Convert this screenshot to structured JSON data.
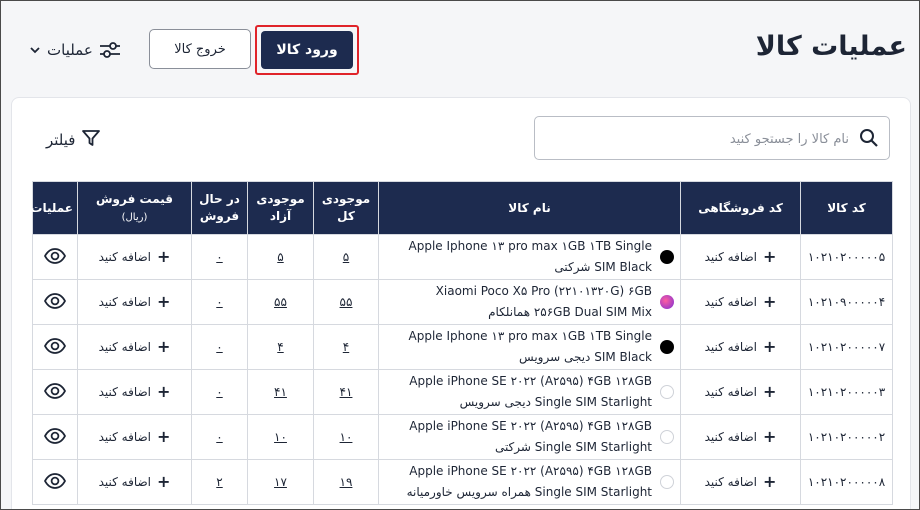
{
  "header": {
    "title": "عملیات کالا",
    "enter_button": "ورود کالا",
    "exit_button": "خروج کالا",
    "ops_menu": "عملیات"
  },
  "search": {
    "placeholder": "نام کالا را جستجو کنید"
  },
  "filter": {
    "label": "فیلتر"
  },
  "table": {
    "headers": {
      "code": "کد کالا",
      "shop_code": "کد فروشگاهی",
      "name": "نام کالا",
      "total_stock": "موجودی کل",
      "free_stock": "موجودی آزاد",
      "selling": "در حال فروش",
      "price": "قیمت فروش",
      "price_unit": "(ریال)",
      "ops": "عملیات"
    },
    "add_label": "اضافه کنید",
    "rows": [
      {
        "code": "۱۰۲۱۰۲۰۰۰۰۰۵",
        "name_line1": "Apple Iphone ۱۳ pro max ۱GB ۱TB Single",
        "name_line2": "SIM Black شرکتی",
        "color": "black",
        "total": "۵",
        "free": "۵",
        "selling": "۰"
      },
      {
        "code": "۱۰۲۱۰۹۰۰۰۰۰۴",
        "name_line1": "Xiaomi Poco X۵ Pro (۲۲۱۰۱۳۲۰G) ۶GB",
        "name_line2": "۲۵۶GB Dual SIM Mix همانلکام",
        "color": "purple",
        "total": "۵۵",
        "free": "۵۵",
        "selling": "۰"
      },
      {
        "code": "۱۰۲۱۰۲۰۰۰۰۰۷",
        "name_line1": "Apple Iphone ۱۳ pro max ۱GB ۱TB Single",
        "name_line2": "SIM Black دیجی سرویس",
        "color": "black",
        "total": "۴",
        "free": "۴",
        "selling": "۰"
      },
      {
        "code": "۱۰۲۱۰۲۰۰۰۰۰۳",
        "name_line1": "Apple iPhone SE ۲۰۲۲ (A۲۵۹۵) ۴GB ۱۲۸GB",
        "name_line2": "Single SIM Starlight دیجی سرویس",
        "color": "light",
        "total": "۴۱",
        "free": "۴۱",
        "selling": "۰"
      },
      {
        "code": "۱۰۲۱۰۲۰۰۰۰۰۲",
        "name_line1": "Apple iPhone SE ۲۰۲۲ (A۲۵۹۵) ۴GB ۱۲۸GB",
        "name_line2": "Single SIM Starlight شرکتی",
        "color": "light",
        "total": "۱۰",
        "free": "۱۰",
        "selling": "۰"
      },
      {
        "code": "۱۰۲۱۰۲۰۰۰۰۰۸",
        "name_line1": "Apple iPhone SE ۲۰۲۲ (A۲۵۹۵) ۴GB ۱۲۸GB",
        "name_line2": "Single SIM Starlight همراه سرویس خاورمیانه",
        "color": "light",
        "total": "۱۹",
        "free": "۱۷",
        "selling": "۲"
      }
    ]
  },
  "colors": {
    "primary": "#1d2b4f",
    "highlight_border": "#e0242a"
  }
}
